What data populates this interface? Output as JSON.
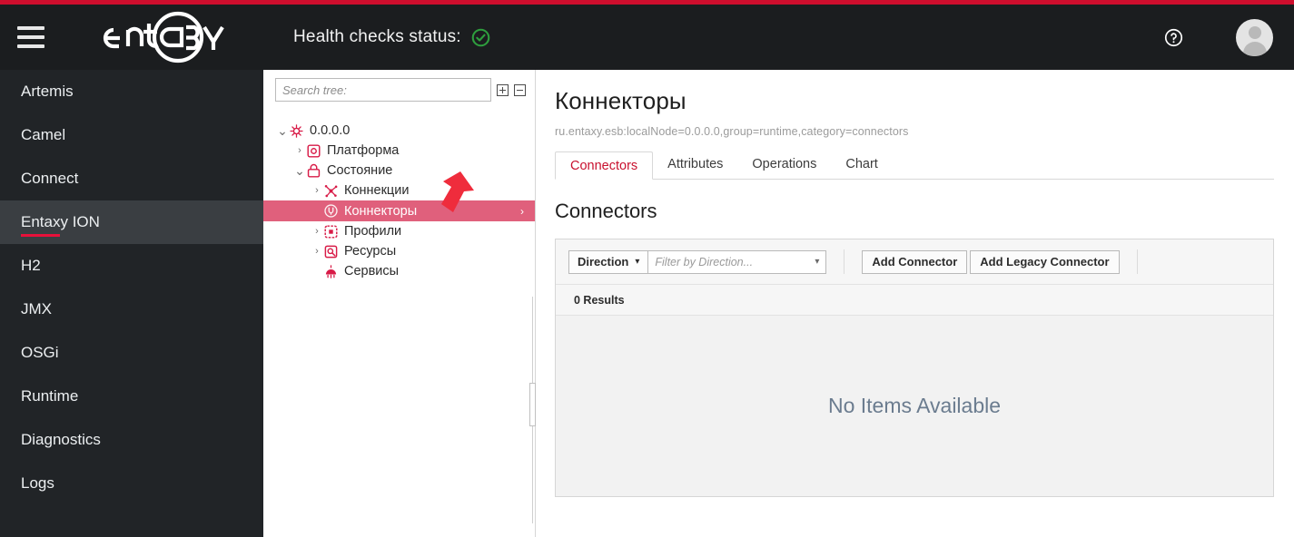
{
  "theme": {
    "accent_red": "#ce0e2d",
    "header_bg": "#1b1d1f",
    "sidenav_bg": "#212427",
    "tree_selected_bg": "#e0607c",
    "tab_active_color": "#c8102e",
    "health_ok_color": "#2e9e3e"
  },
  "header": {
    "menu_icon": "hamburger-icon",
    "logo_text": "ENTAXY",
    "health_label": "Health checks status:",
    "health_icon": "check-circle-icon",
    "help_icon": "help-circle-icon",
    "avatar_icon": "user-avatar-icon"
  },
  "sidenav": {
    "items": [
      {
        "label": "Artemis",
        "active": false
      },
      {
        "label": "Camel",
        "active": false
      },
      {
        "label": "Connect",
        "active": false
      },
      {
        "label": "Entaxy ION",
        "active": true
      },
      {
        "label": "H2",
        "active": false
      },
      {
        "label": "JMX",
        "active": false
      },
      {
        "label": "OSGi",
        "active": false
      },
      {
        "label": "Runtime",
        "active": false
      },
      {
        "label": "Diagnostics",
        "active": false
      },
      {
        "label": "Logs",
        "active": false
      }
    ]
  },
  "tree_panel": {
    "search_placeholder": "Search tree:",
    "search_value": "",
    "expand_all_icon": "expand-all-icon",
    "collapse_all_icon": "collapse-all-icon",
    "nodes": [
      {
        "label": "0.0.0.0",
        "depth": 0,
        "caret": "open",
        "icon": "node-root-icon",
        "selected": false
      },
      {
        "label": "Платформа",
        "depth": 1,
        "caret": "closed",
        "icon": "platform-icon",
        "selected": false
      },
      {
        "label": "Состояние",
        "depth": 1,
        "caret": "open",
        "icon": "state-icon",
        "selected": false
      },
      {
        "label": "Коннекции",
        "depth": 2,
        "caret": "closed",
        "icon": "connections-icon",
        "selected": false
      },
      {
        "label": "Коннекторы",
        "depth": 2,
        "caret": "none",
        "icon": "connectors-icon",
        "selected": true
      },
      {
        "label": "Профили",
        "depth": 2,
        "caret": "closed",
        "icon": "profiles-icon",
        "selected": false
      },
      {
        "label": "Ресурсы",
        "depth": 2,
        "caret": "closed",
        "icon": "resources-icon",
        "selected": false
      },
      {
        "label": "Сервисы",
        "depth": 2,
        "caret": "none",
        "icon": "services-icon",
        "selected": false
      }
    ]
  },
  "main": {
    "mbean_title": "Коннекторы",
    "mbean_path": "ru.entaxy.esb:localNode=0.0.0.0,group=runtime,category=connectors",
    "tabs": [
      {
        "label": "Connectors",
        "active": true
      },
      {
        "label": "Attributes",
        "active": false
      },
      {
        "label": "Operations",
        "active": false
      },
      {
        "label": "Chart",
        "active": false
      }
    ],
    "panel_title": "Connectors",
    "toolbar": {
      "direction_dropdown_label": "Direction",
      "direction_dropdown_icon": "chevron-down-icon",
      "filter_placeholder": "Filter by Direction...",
      "filter_value": "",
      "filter_chevron_icon": "chevron-down-icon",
      "add_connector_label": "Add Connector",
      "add_legacy_connector_label": "Add Legacy Connector"
    },
    "results_text": "0 Results",
    "empty_text": "No Items Available"
  }
}
